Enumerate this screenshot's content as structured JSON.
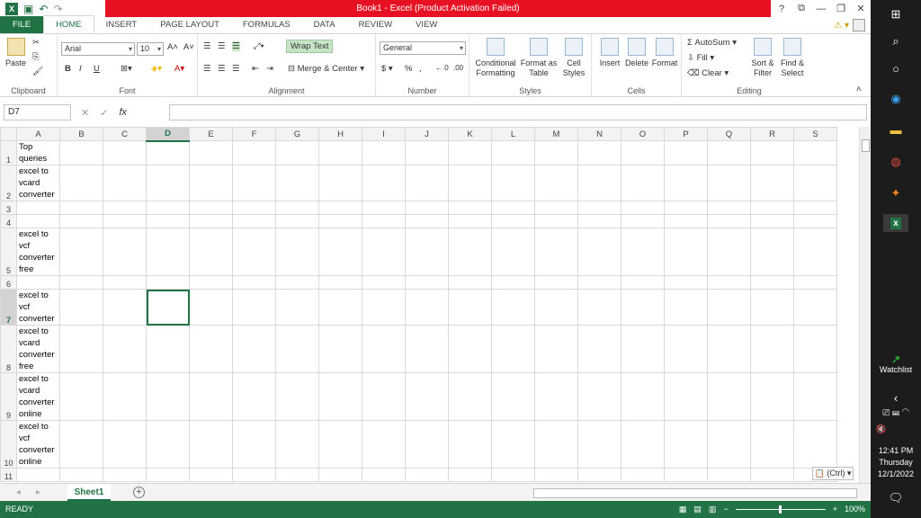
{
  "title": {
    "text": "Book1 -  Excel (Product Activation Failed)",
    "help": "?",
    "controls": [
      "?",
      "🗗",
      "—",
      "🗗",
      "✕"
    ]
  },
  "tabs": [
    "FILE",
    "HOME",
    "INSERT",
    "PAGE LAYOUT",
    "FORMULAS",
    "DATA",
    "REVIEW",
    "VIEW"
  ],
  "ribbon": {
    "clipboard": {
      "paste": "Paste",
      "label": "Clipboard"
    },
    "font": {
      "name": "Arial",
      "size": "10",
      "bold": "B",
      "italic": "I",
      "underline": "U",
      "label": "Font"
    },
    "alignment": {
      "wrap": "Wrap Text",
      "merge": "Merge & Center",
      "label": "Alignment"
    },
    "number": {
      "format": "General",
      "currency": "$",
      "percent": "%",
      "comma": ",",
      "label": "Number"
    },
    "styles": {
      "conditional": "Conditional Formatting",
      "table": "Format as Table",
      "cell": "Cell Styles",
      "label": "Styles"
    },
    "cells": {
      "insert": "Insert",
      "delete": "Delete",
      "format": "Format",
      "label": "Cells"
    },
    "editing": {
      "autosum": "AutoSum",
      "fill": "Fill",
      "clear": "Clear",
      "sort": "Sort & Filter",
      "find": "Find & Select",
      "label": "Editing"
    }
  },
  "formula_bar": {
    "name_box": "D7",
    "fx": "fx",
    "value": ""
  },
  "columns": [
    "A",
    "B",
    "C",
    "D",
    "E",
    "F",
    "G",
    "H",
    "I",
    "J",
    "K",
    "L",
    "M",
    "N",
    "O",
    "P",
    "Q",
    "R",
    "S"
  ],
  "selected_column": "D",
  "rows": [
    {
      "n": "1",
      "a": "Top queries",
      "h": 27
    },
    {
      "n": "2",
      "a": "excel to vcard converter",
      "h": 40
    },
    {
      "n": "3",
      "a": "",
      "h": 15
    },
    {
      "n": "4",
      "a": "",
      "h": 15
    },
    {
      "n": "5",
      "a": "excel to vcf converter free",
      "h": 53
    },
    {
      "n": "6",
      "a": "",
      "h": 15
    },
    {
      "n": "7",
      "a": "excel to vcf converter",
      "h": 40
    },
    {
      "n": "8",
      "a": "excel to vcard converter free",
      "h": 53
    },
    {
      "n": "9",
      "a": "excel to vcard converter online",
      "h": 53
    },
    {
      "n": "10",
      "a": "excel to vcf converter online",
      "h": 53
    },
    {
      "n": "11",
      "a": "",
      "h": 15
    }
  ],
  "selected_row": "7",
  "paste_options": "(Ctrl)",
  "sheet_tab": "Sheet1",
  "status": {
    "ready": "READY",
    "zoom": "100%"
  },
  "taskbar": {
    "watchlist": "Watchlist",
    "time": "12:41 PM",
    "day": "Thursday",
    "date": "12/1/2022"
  }
}
